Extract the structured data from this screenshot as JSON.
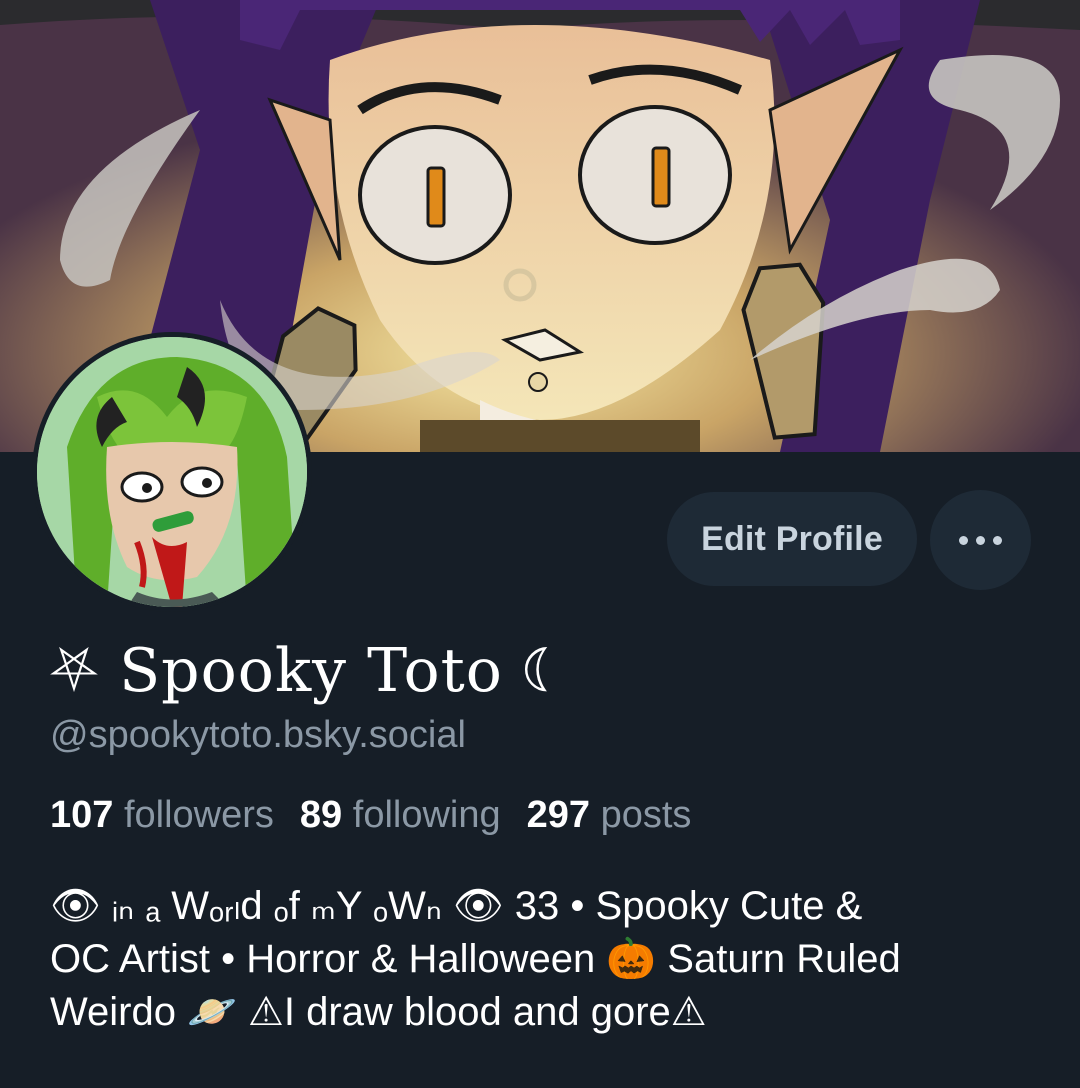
{
  "profile": {
    "display_name": "⛧ Spooky Toto ☾",
    "handle": "@spookytoto.bsky.social",
    "bio_lines": [
      "👁 ᵢₙ ₐ Wₒᵣₗd ₒf ₘY ₒWₙ 👁 33 • Spooky Cute &",
      "OC Artist • Horror & Halloween 🎃 Saturn Ruled",
      "Weirdo 🪐 ⚠I draw blood and gore⚠"
    ]
  },
  "stats": {
    "followers_count": "107",
    "followers_label": "followers",
    "following_count": "89",
    "following_label": "following",
    "posts_count": "297",
    "posts_label": "posts"
  },
  "actions": {
    "edit_profile_label": "Edit Profile"
  },
  "icons": {
    "more": "more-horizontal-icon"
  },
  "colors": {
    "background": "#161e27",
    "button_bg": "#1e2a36",
    "muted_text": "#8b98a5"
  }
}
